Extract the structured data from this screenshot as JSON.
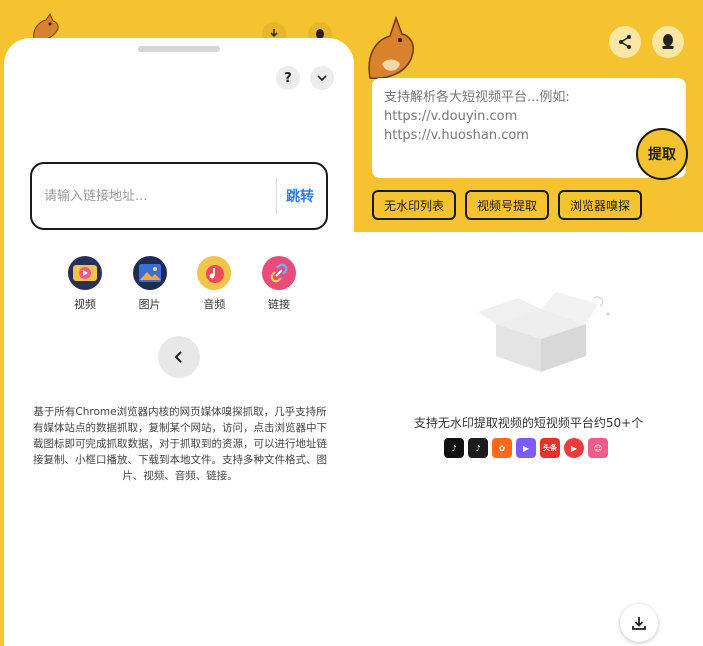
{
  "left_screen": {
    "help_label": "?",
    "url_input": {
      "placeholder": "请输入链接地址...",
      "value": ""
    },
    "jump_label": "跳转",
    "media_types": [
      {
        "label": "视频",
        "icon": "video-icon",
        "color": "#f3c44a"
      },
      {
        "label": "图片",
        "icon": "image-icon",
        "color": "#3a6fd8"
      },
      {
        "label": "音频",
        "icon": "audio-icon",
        "color": "#ef4b5a"
      },
      {
        "label": "链接",
        "icon": "link-icon",
        "color": "#e94b7a"
      }
    ],
    "description": "基于所有Chrome浏览器内核的网页媒体嗅探抓取，几乎支持所有媒体站点的数据抓取，复制某个网站，访问，点击浏览器中下载图标即可完成抓取数据，对于抓取到的资源，可以进行地址链接复制、小框口播放、下载到本地文件。支持多种文件格式、图片、视频、音频、链接。"
  },
  "right_screen": {
    "textarea_placeholder_lines": [
      "支持解析各大短视频平台...例如:",
      "https://v.douyin.com",
      "https://v.huoshan.com"
    ],
    "extract_label": "提取",
    "tool_buttons": [
      "无水印列表",
      "视频号提取",
      "浏览器嗅探"
    ],
    "support_text": "支持无水印提取视频的短视频平台约50+个",
    "platforms": [
      {
        "icon": "douyin-icon",
        "color": "#111111",
        "glyph": "♪"
      },
      {
        "icon": "douyin-lite-icon",
        "color": "#1c1c1c",
        "glyph": "♪"
      },
      {
        "icon": "kuaishou-icon",
        "color": "#ff6a1a",
        "glyph": "✿"
      },
      {
        "icon": "weishi-icon",
        "color": "#7b5cff",
        "glyph": "▶"
      },
      {
        "icon": "toutiao-icon",
        "color": "#e8312c",
        "glyph": "头条"
      },
      {
        "icon": "xigua-icon",
        "color": "#f23a3a",
        "glyph": "▶"
      },
      {
        "icon": "pipi-icon",
        "color": "#f25c8a",
        "glyph": "☺"
      }
    ]
  },
  "colors": {
    "brand_yellow": "#f5c330",
    "link_blue": "#2f7de1",
    "dark": "#1a1a1a"
  }
}
